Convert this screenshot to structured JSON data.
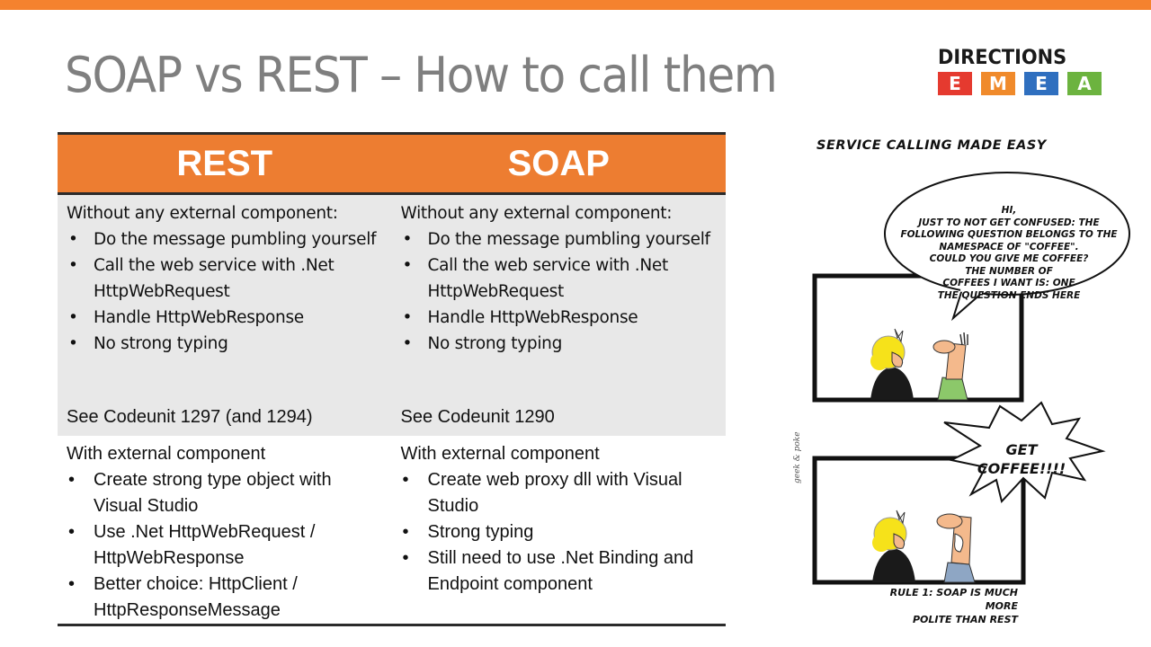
{
  "slide": {
    "title": "SOAP vs REST – How to call them",
    "accent_color": "#f5822e"
  },
  "logo": {
    "word": "DIRECTIONS",
    "tiles": [
      {
        "letter": "E",
        "color": "#e53a2f"
      },
      {
        "letter": "M",
        "color": "#f08a2b"
      },
      {
        "letter": "E",
        "color": "#2f6fbf"
      },
      {
        "letter": "A",
        "color": "#6cb33f"
      }
    ]
  },
  "table": {
    "header_color": "#ed7d31",
    "columns": [
      {
        "heading": "REST",
        "without": {
          "intro": "Without any external component:",
          "bullets": [
            "Do the message pumbling yourself",
            "Call the web service with .Net HttpWebRequest",
            "Handle HttpWebResponse",
            "No strong typing"
          ],
          "see": "See Codeunit 1297 (and 1294)"
        },
        "with": {
          "intro": "With external component",
          "bullets": [
            "Create strong type object with Visual Studio",
            "Use .Net HttpWebRequest / HttpWebResponse",
            "Better choice: HttpClient / HttpResponseMessage"
          ]
        }
      },
      {
        "heading": "SOAP",
        "without": {
          "intro": "Without any external component:",
          "bullets": [
            "Do the message pumbling yourself",
            "Call the web service with .Net HttpWebRequest",
            "Handle HttpWebResponse",
            "No strong typing"
          ],
          "see": "See Codeunit 1290"
        },
        "with": {
          "intro": "With external component",
          "bullets": [
            "Create web proxy dll with Visual Studio",
            "Strong typing",
            "Still need to use .Net Binding and Endpoint component"
          ]
        }
      }
    ]
  },
  "comic": {
    "title": "SERVICE CALLING MADE EASY",
    "bubble1_lines": [
      "HI,",
      "JUST TO NOT GET CONFUSED: THE",
      "FOLLOWING QUESTION BELONGS TO THE",
      "NAMESPACE OF \"COFFEE\".",
      "COULD YOU GIVE ME COFFEE?",
      "THE NUMBER OF",
      "COFFEES I WANT IS: ONE",
      "THE QUESTION ENDS HERE"
    ],
    "bubble2_lines": [
      "GET",
      "COFFEE!!!!"
    ],
    "caption_lines": [
      "RULE 1: SOAP IS MUCH MORE",
      "POLITE THAN REST"
    ],
    "credit": "geek & poke"
  }
}
